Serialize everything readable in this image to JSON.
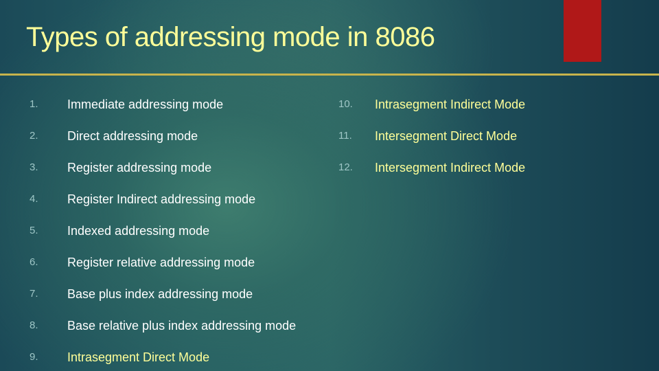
{
  "slide": {
    "title": "Types of addressing mode in 8086",
    "accent_colors": {
      "title": "#ffff99",
      "rule": "#c8b44c",
      "bar": "#b01818",
      "numbers": "#9fc7c7"
    },
    "left_column": [
      {
        "number": "1.",
        "text": "Immediate addressing mode",
        "highlight": false
      },
      {
        "number": "2.",
        "text": "Direct addressing mode",
        "highlight": false
      },
      {
        "number": "3.",
        "text": "Register addressing mode",
        "highlight": false
      },
      {
        "number": "4.",
        "text": "Register Indirect addressing mode",
        "highlight": false
      },
      {
        "number": "5.",
        "text": "Indexed addressing mode",
        "highlight": false
      },
      {
        "number": "6.",
        "text": "Register relative addressing mode",
        "highlight": false
      },
      {
        "number": "7.",
        "text": "Base plus index addressing mode",
        "highlight": false
      },
      {
        "number": "8.",
        "text": "Base relative plus index addressing mode",
        "highlight": false
      },
      {
        "number": "9.",
        "text": "Intrasegment Direct Mode",
        "highlight": true
      }
    ],
    "right_column": [
      {
        "number": "10.",
        "text": "Intrasegment Indirect Mode",
        "highlight": true
      },
      {
        "number": "11.",
        "text": "Intersegment Direct Mode",
        "highlight": true
      },
      {
        "number": "12.",
        "text": "Intersegment Indirect Mode",
        "highlight": true
      }
    ]
  }
}
